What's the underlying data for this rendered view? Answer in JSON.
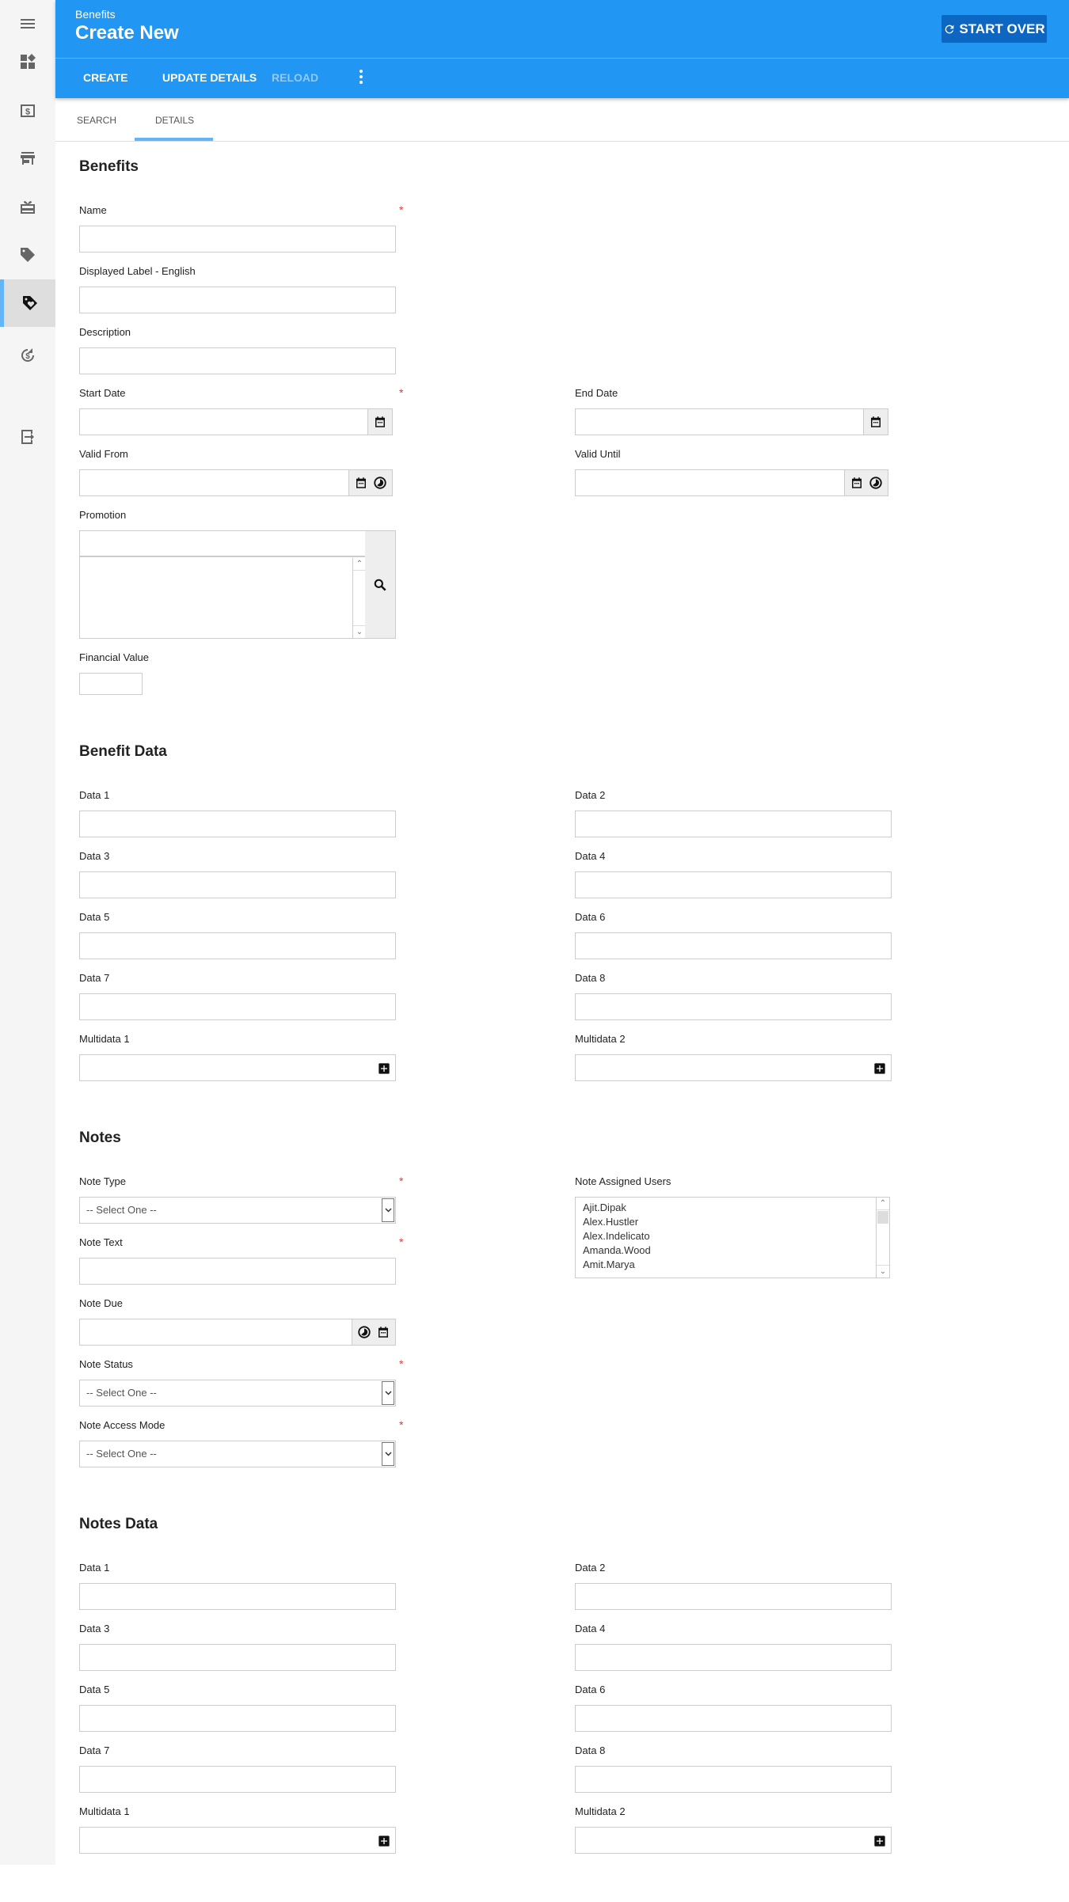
{
  "sidebar": {
    "items": [
      {
        "icon": "menu-icon"
      },
      {
        "icon": "dashboard-icon"
      },
      {
        "icon": "dollar-box-icon"
      },
      {
        "icon": "store-icon"
      },
      {
        "icon": "gift-card-icon"
      },
      {
        "icon": "tag-icon"
      },
      {
        "icon": "tag-heart-icon",
        "active": true
      },
      {
        "icon": "dollar-cycle-icon"
      },
      {
        "icon": "logout-icon"
      }
    ]
  },
  "header": {
    "breadcrumb": "Benefits",
    "title": "Create New",
    "start_over": "START OVER",
    "color": "#2196f3"
  },
  "toolbar": {
    "create": "CREATE",
    "update_details": "UPDATE DETAILS",
    "reload": "RELOAD"
  },
  "tabs": [
    {
      "label": "SEARCH"
    },
    {
      "label": "DETAILS",
      "active": true
    }
  ],
  "sections": [
    {
      "title": "Benefits",
      "rows": [
        [
          {
            "label": "Name",
            "type": "text",
            "required": true
          }
        ],
        [
          {
            "label": "Displayed Label - English",
            "type": "text"
          }
        ],
        [
          {
            "label": "Description",
            "type": "text"
          }
        ],
        [
          {
            "label": "Start Date",
            "type": "date",
            "required": true,
            "icons": [
              "calendar-icon"
            ]
          },
          {
            "label": "End Date",
            "type": "date",
            "icons": [
              "calendar-icon"
            ]
          }
        ],
        [
          {
            "label": "Valid From",
            "type": "date",
            "icons": [
              "calendar-icon",
              "clock-icon"
            ]
          },
          {
            "label": "Valid Until",
            "type": "date",
            "icons": [
              "calendar-icon",
              "clock-icon"
            ]
          }
        ],
        [
          {
            "label": "Promotion",
            "type": "lookup"
          }
        ],
        [
          {
            "label": "Financial Value",
            "type": "small"
          }
        ]
      ]
    },
    {
      "title": "Benefit Data",
      "rows": [
        [
          {
            "label": "Data 1",
            "type": "text"
          },
          {
            "label": "Data 2",
            "type": "text"
          }
        ],
        [
          {
            "label": "Data 3",
            "type": "text"
          },
          {
            "label": "Data 4",
            "type": "text"
          }
        ],
        [
          {
            "label": "Data 5",
            "type": "text"
          },
          {
            "label": "Data 6",
            "type": "text"
          }
        ],
        [
          {
            "label": "Data 7",
            "type": "text"
          },
          {
            "label": "Data 8",
            "type": "text"
          }
        ],
        [
          {
            "label": "Multidata 1",
            "type": "multi"
          },
          {
            "label": "Multidata 2",
            "type": "multi"
          }
        ]
      ]
    },
    {
      "title": "Notes",
      "rows": [
        [
          {
            "label": "Note Type",
            "type": "select",
            "required": true,
            "value": "-- Select One --"
          },
          {
            "label": "Note Assigned Users",
            "type": "listbox",
            "options": [
              "Ajit.Dipak",
              "Alex.Hustler",
              "Alex.Indelicato",
              "Amanda.Wood",
              "Amit.Marya"
            ]
          }
        ],
        [
          {
            "label": "Note Text",
            "type": "text",
            "required": true
          }
        ],
        [
          {
            "label": "Note Due",
            "type": "date",
            "icons": [
              "clock-icon",
              "calendar-icon"
            ]
          }
        ],
        [
          {
            "label": "Note Status",
            "type": "select",
            "required": true,
            "value": "-- Select One --"
          }
        ],
        [
          {
            "label": "Note Access Mode",
            "type": "select",
            "required": true,
            "value": "-- Select One --"
          }
        ]
      ]
    },
    {
      "title": "Notes Data",
      "rows": [
        [
          {
            "label": "Data 1",
            "type": "text"
          },
          {
            "label": "Data 2",
            "type": "text"
          }
        ],
        [
          {
            "label": "Data 3",
            "type": "text"
          },
          {
            "label": "Data 4",
            "type": "text"
          }
        ],
        [
          {
            "label": "Data 5",
            "type": "text"
          },
          {
            "label": "Data 6",
            "type": "text"
          }
        ],
        [
          {
            "label": "Data 7",
            "type": "text"
          },
          {
            "label": "Data 8",
            "type": "text"
          }
        ],
        [
          {
            "label": "Multidata 1",
            "type": "multi"
          },
          {
            "label": "Multidata 2",
            "type": "multi"
          }
        ]
      ]
    }
  ]
}
